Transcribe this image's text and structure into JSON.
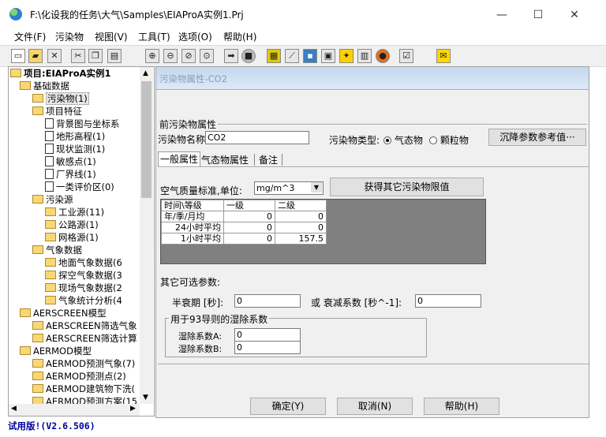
{
  "window": {
    "title": "F:\\化设我的任务\\大气\\Samples\\EIAProA实例1.Prj",
    "minimize": "—",
    "maximize": "☐",
    "close": "✕"
  },
  "menu": [
    "文件(F)",
    "污染物",
    "视图(V)",
    "工具(T)",
    "选项(O)",
    "帮助(H)"
  ],
  "toolbar_icons": [
    "new-icon",
    "open-icon",
    "delete-icon",
    "cut-icon",
    "copy-icon",
    "paste-icon",
    "zoom-in-icon",
    "zoom-out-icon",
    "zoom-window-icon",
    "zoom-extent-icon",
    "run-icon",
    "stop-icon",
    "grid-icon",
    "chart-icon",
    "calculator-icon",
    "print-icon",
    "map-icon",
    "dem-icon",
    "globe-icon",
    "settings-icon",
    "envelope-icon"
  ],
  "tree": [
    {
      "label": "项目:EIAProA实例1",
      "type": "folder",
      "level": 0,
      "bold": true
    },
    {
      "label": "基础数据",
      "type": "folder",
      "level": 1
    },
    {
      "label": "污染物(1)",
      "type": "folder",
      "level": 2,
      "selected": true
    },
    {
      "label": "项目特征",
      "type": "folder",
      "level": 2
    },
    {
      "label": "背景图与坐标系",
      "type": "doc",
      "level": 3
    },
    {
      "label": "地形高程(1)",
      "type": "doc",
      "level": 3
    },
    {
      "label": "现状监测(1)",
      "type": "doc",
      "level": 3
    },
    {
      "label": "敏感点(1)",
      "type": "doc",
      "level": 3
    },
    {
      "label": "厂界线(1)",
      "type": "doc",
      "level": 3
    },
    {
      "label": "一类评价区(0)",
      "type": "doc",
      "level": 3
    },
    {
      "label": "污染源",
      "type": "folder",
      "level": 2
    },
    {
      "label": "工业源(11)",
      "type": "folder",
      "level": 3
    },
    {
      "label": "公路源(1)",
      "type": "folder",
      "level": 3
    },
    {
      "label": "网格源(1)",
      "type": "folder",
      "level": 3
    },
    {
      "label": "气象数据",
      "type": "folder",
      "level": 2
    },
    {
      "label": "地面气象数据(6",
      "type": "folder",
      "level": 3
    },
    {
      "label": "探空气象数据(3",
      "type": "folder",
      "level": 3
    },
    {
      "label": "现场气象数据(2",
      "type": "folder",
      "level": 3
    },
    {
      "label": "气象统计分析(4",
      "type": "folder",
      "level": 3
    },
    {
      "label": "AERSCREEN模型",
      "type": "folder",
      "level": 1
    },
    {
      "label": "AERSCREEN筛选气象",
      "type": "folder",
      "level": 2
    },
    {
      "label": "AERSCREEN筛选计算",
      "type": "folder",
      "level": 2
    },
    {
      "label": "AERMOD模型",
      "type": "folder",
      "level": 1
    },
    {
      "label": "AERMOD预测气象(7)",
      "type": "folder",
      "level": 2
    },
    {
      "label": "AERMOD预测点(2)",
      "type": "folder",
      "level": 2
    },
    {
      "label": "AERMOD建筑物下洗(",
      "type": "folder",
      "level": 2
    },
    {
      "label": "AERMOD预测方案(15",
      "type": "folder",
      "level": 2
    }
  ],
  "status": "试用版!(V2.6.506)",
  "dialog": {
    "title": "污染物属性-CO2",
    "group_title": "前污染物属性",
    "name_label": "污染物名称:",
    "name_value": "CO2",
    "type_label": "污染物类型:",
    "type_gas": "气态物",
    "type_particle": "颗粒物",
    "type_selected": "气态物",
    "deposition_button": "沉降参数参考值···",
    "tabs": [
      "一般属性",
      "气态物属性",
      "备注"
    ],
    "active_tab": "一般属性",
    "aq_label": "空气质量标准,单位:",
    "unit_value": "mg/m^3",
    "fetch_button": "获得其它污染物限值",
    "table": {
      "headers": [
        "时间\\等级",
        "一级",
        "二级"
      ],
      "rows": [
        [
          "年/季/月均",
          "0",
          "0"
        ],
        [
          "24小时平均",
          "0",
          "0"
        ],
        [
          "1小时平均",
          "0",
          "157.5"
        ]
      ]
    },
    "optional_label": "其它可选参数:",
    "halflife_label": "半衰期 [秒]:",
    "halflife_value": "0",
    "or_label": "或 衰减系数  [秒^-1]:",
    "decay_value": "0",
    "wet_group_title": "用于93导则的湿除系数",
    "wet_a_label": "湿除系数A:",
    "wet_a_value": "0",
    "wet_b_label": "湿除系数B:",
    "wet_b_value": "0",
    "ok_button": "确定(Y)",
    "cancel_button": "取消(N)",
    "help_button": "帮助(H)"
  }
}
